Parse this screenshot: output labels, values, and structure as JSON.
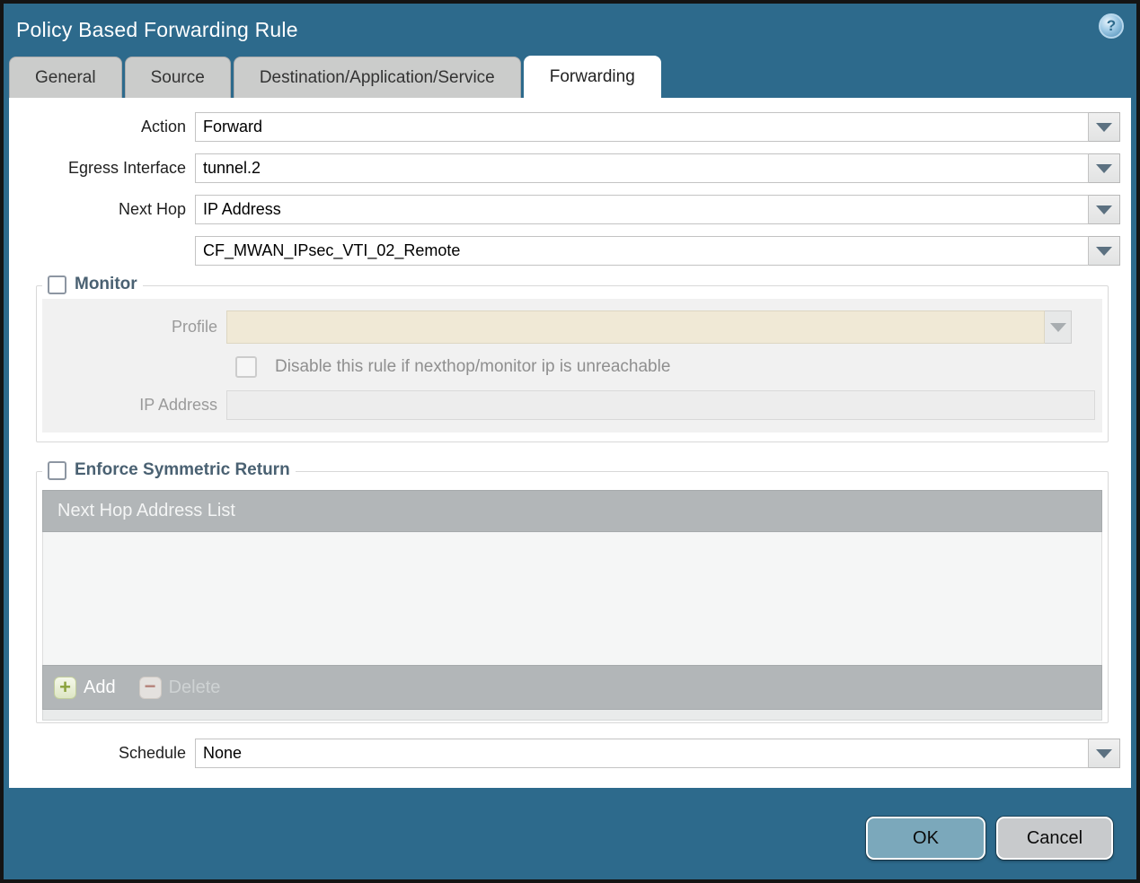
{
  "window": {
    "title": "Policy Based Forwarding Rule",
    "help_glyph": "?"
  },
  "tabs": [
    {
      "label": "General",
      "active": false
    },
    {
      "label": "Source",
      "active": false
    },
    {
      "label": "Destination/Application/Service",
      "active": false
    },
    {
      "label": "Forwarding",
      "active": true
    }
  ],
  "form": {
    "action": {
      "label": "Action",
      "value": "Forward"
    },
    "egress_interface": {
      "label": "Egress Interface",
      "value": "tunnel.2"
    },
    "next_hop": {
      "label": "Next Hop",
      "value": "IP Address"
    },
    "next_hop_address": {
      "value": "CF_MWAN_IPsec_VTI_02_Remote"
    },
    "schedule": {
      "label": "Schedule",
      "value": "None"
    }
  },
  "monitor": {
    "title": "Monitor",
    "checked": false,
    "profile_label": "Profile",
    "profile_value": "",
    "disable_rule_label": "Disable this rule if nexthop/monitor ip is unreachable",
    "disable_rule_checked": false,
    "ip_address_label": "IP Address",
    "ip_address_value": ""
  },
  "symmetric_return": {
    "title": "Enforce Symmetric Return",
    "checked": false,
    "table_header": "Next Hop Address List",
    "rows": [],
    "add_label": "Add",
    "delete_label": "Delete",
    "plus_glyph": "+",
    "minus_glyph": "−"
  },
  "footer": {
    "ok_label": "OK",
    "cancel_label": "Cancel"
  },
  "colors": {
    "titlebar_teal": "#2d6a8c",
    "active_tab": "#ffffff",
    "inactive_tab": "#cbcccb",
    "section_title": "#4a6172",
    "table_gray": "#b2b6b8",
    "profile_disabled_beige": "#f0e9d6",
    "ok_button": "#7ba8bb",
    "cancel_button": "#c8cacc"
  }
}
